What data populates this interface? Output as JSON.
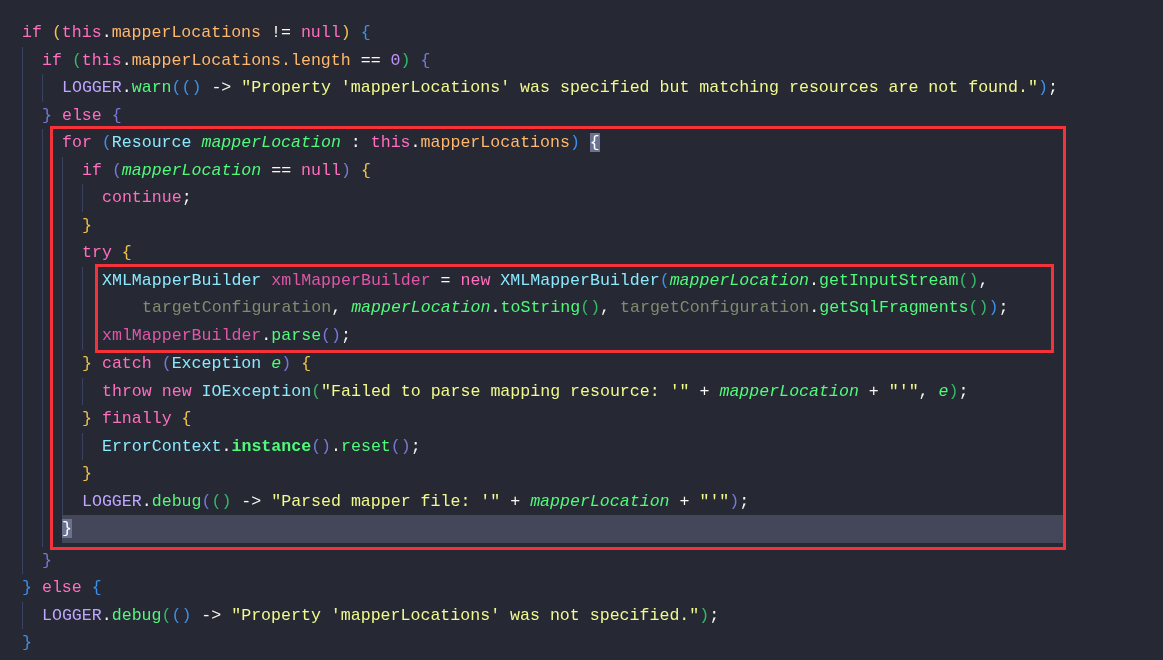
{
  "editor": {
    "lines": [
      {
        "kind": "line",
        "current": false,
        "tokens": [
          {
            "text": "if ",
            "kind": "keyword"
          },
          {
            "text": "(",
            "kind": "bracket1"
          },
          {
            "text": "this",
            "kind": "keyword"
          },
          {
            "text": ".",
            "kind": "plain"
          },
          {
            "text": "mapperLocations",
            "kind": "field"
          },
          {
            "text": " != ",
            "kind": "plain"
          },
          {
            "text": "null",
            "kind": "keyword"
          },
          {
            "text": ")",
            "kind": "bracket1"
          },
          {
            "text": " {",
            "kind": "bracket2"
          }
        ],
        "children": [
          {
            "kind": "line",
            "current": false,
            "tokens": [
              {
                "text": "if ",
                "kind": "keyword"
              },
              {
                "text": "(",
                "kind": "bracket3"
              },
              {
                "text": "this",
                "kind": "keyword"
              },
              {
                "text": ".",
                "kind": "plain"
              },
              {
                "text": "mapperLocations.length",
                "kind": "field"
              },
              {
                "text": " == ",
                "kind": "plain"
              },
              {
                "text": "0",
                "kind": "number"
              },
              {
                "text": ")",
                "kind": "bracket3"
              },
              {
                "text": " {",
                "kind": "bracket4"
              }
            ],
            "children": [
              {
                "kind": "line",
                "current": false,
                "tokens": [
                  {
                    "text": "LOGGER",
                    "kind": "constant"
                  },
                  {
                    "text": ".",
                    "kind": "plain"
                  },
                  {
                    "text": "warn",
                    "kind": "method"
                  },
                  {
                    "text": "(()",
                    "kind": "bracket2"
                  },
                  {
                    "text": " -> ",
                    "kind": "plain"
                  },
                  {
                    "text": "\"Property 'mapperLocations' was specified but matching resources are not found.\"",
                    "kind": "string"
                  },
                  {
                    "text": ")",
                    "kind": "bracket2"
                  },
                  {
                    "text": ";",
                    "kind": "plain"
                  }
                ]
              }
            ]
          },
          {
            "kind": "line",
            "current": false,
            "tokens": [
              {
                "text": "} ",
                "kind": "bracket4"
              },
              {
                "text": "else ",
                "kind": "keyword"
              },
              {
                "text": "{",
                "kind": "bracket4"
              }
            ],
            "children": [
              {
                "kind": "box",
                "children": [
                  {
                    "kind": "line",
                    "current": false,
                    "tokens": [
                      {
                        "text": "for ",
                        "kind": "keyword"
                      },
                      {
                        "text": "(",
                        "kind": "bracket2"
                      },
                      {
                        "text": "Resource ",
                        "kind": "class"
                      },
                      {
                        "text": "mapperLocation",
                        "kind": "param"
                      },
                      {
                        "text": " : ",
                        "kind": "plain"
                      },
                      {
                        "text": "this",
                        "kind": "keyword"
                      },
                      {
                        "text": ".",
                        "kind": "plain"
                      },
                      {
                        "text": "mapperLocations",
                        "kind": "field"
                      },
                      {
                        "text": ") ",
                        "kind": "bracket2"
                      },
                      {
                        "text": "{",
                        "kind": "match"
                      }
                    ],
                    "children": [
                      {
                        "kind": "line",
                        "current": false,
                        "tokens": [
                          {
                            "text": "if ",
                            "kind": "keyword"
                          },
                          {
                            "text": "(",
                            "kind": "bracket4"
                          },
                          {
                            "text": "mapperLocation",
                            "kind": "param"
                          },
                          {
                            "text": " == ",
                            "kind": "plain"
                          },
                          {
                            "text": "null",
                            "kind": "keyword"
                          },
                          {
                            "text": ")",
                            "kind": "bracket4"
                          },
                          {
                            "text": " {",
                            "kind": "bracket1"
                          }
                        ],
                        "children": [
                          {
                            "kind": "line",
                            "current": false,
                            "tokens": [
                              {
                                "text": "continue",
                                "kind": "keyword"
                              },
                              {
                                "text": ";",
                                "kind": "plain"
                              }
                            ]
                          }
                        ]
                      },
                      {
                        "kind": "line",
                        "current": false,
                        "tokens": [
                          {
                            "text": "}",
                            "kind": "bracket1"
                          }
                        ]
                      },
                      {
                        "kind": "line",
                        "current": false,
                        "tokens": [
                          {
                            "text": "try ",
                            "kind": "keyword"
                          },
                          {
                            "text": "{",
                            "kind": "bracket1"
                          }
                        ],
                        "children": [
                          {
                            "kind": "box",
                            "children": [
                              {
                                "kind": "line",
                                "current": false,
                                "tokens": [
                                  {
                                    "text": "XMLMapperBuilder ",
                                    "kind": "class"
                                  },
                                  {
                                    "text": "xmlMapperBuilder",
                                    "kind": "local"
                                  },
                                  {
                                    "text": " = ",
                                    "kind": "plain"
                                  },
                                  {
                                    "text": "new ",
                                    "kind": "keyword"
                                  },
                                  {
                                    "text": "XMLMapperBuilder",
                                    "kind": "class"
                                  },
                                  {
                                    "text": "(",
                                    "kind": "bracket2"
                                  },
                                  {
                                    "text": "mapperLocation",
                                    "kind": "param"
                                  },
                                  {
                                    "text": ".",
                                    "kind": "plain"
                                  },
                                  {
                                    "text": "getInputStream",
                                    "kind": "method"
                                  },
                                  {
                                    "text": "()",
                                    "kind": "bracket3"
                                  },
                                  {
                                    "text": ",",
                                    "kind": "plain"
                                  }
                                ]
                              },
                              {
                                "kind": "continuation",
                                "current": false,
                                "tokens": [
                                  {
                                    "text": "targetConfiguration",
                                    "kind": "muted"
                                  },
                                  {
                                    "text": ", ",
                                    "kind": "plain"
                                  },
                                  {
                                    "text": "mapperLocation",
                                    "kind": "param"
                                  },
                                  {
                                    "text": ".",
                                    "kind": "plain"
                                  },
                                  {
                                    "text": "toString",
                                    "kind": "method"
                                  },
                                  {
                                    "text": "()",
                                    "kind": "bracket3"
                                  },
                                  {
                                    "text": ", ",
                                    "kind": "plain"
                                  },
                                  {
                                    "text": "targetConfiguration",
                                    "kind": "muted"
                                  },
                                  {
                                    "text": ".",
                                    "kind": "plain"
                                  },
                                  {
                                    "text": "getSqlFragments",
                                    "kind": "method"
                                  },
                                  {
                                    "text": "()",
                                    "kind": "bracket3"
                                  },
                                  {
                                    "text": ")",
                                    "kind": "bracket2"
                                  },
                                  {
                                    "text": ";",
                                    "kind": "plain"
                                  }
                                ]
                              },
                              {
                                "kind": "line",
                                "current": false,
                                "tokens": [
                                  {
                                    "text": "xmlMapperBuilder",
                                    "kind": "local"
                                  },
                                  {
                                    "text": ".",
                                    "kind": "plain"
                                  },
                                  {
                                    "text": "parse",
                                    "kind": "method"
                                  },
                                  {
                                    "text": "()",
                                    "kind": "bracket4"
                                  },
                                  {
                                    "text": ";",
                                    "kind": "plain"
                                  }
                                ]
                              }
                            ]
                          }
                        ]
                      },
                      {
                        "kind": "line",
                        "current": false,
                        "tokens": [
                          {
                            "text": "} ",
                            "kind": "bracket1"
                          },
                          {
                            "text": "catch ",
                            "kind": "keyword"
                          },
                          {
                            "text": "(",
                            "kind": "bracket4"
                          },
                          {
                            "text": "Exception ",
                            "kind": "class"
                          },
                          {
                            "text": "e",
                            "kind": "param"
                          },
                          {
                            "text": ")",
                            "kind": "bracket4"
                          },
                          {
                            "text": " {",
                            "kind": "bracket1"
                          }
                        ],
                        "children": [
                          {
                            "kind": "line",
                            "current": false,
                            "tokens": [
                              {
                                "text": "throw new ",
                                "kind": "keyword"
                              },
                              {
                                "text": "IOException",
                                "kind": "class"
                              },
                              {
                                "text": "(",
                                "kind": "bracket3"
                              },
                              {
                                "text": "\"Failed to parse mapping resource: '\"",
                                "kind": "string"
                              },
                              {
                                "text": " + ",
                                "kind": "plain"
                              },
                              {
                                "text": "mapperLocation",
                                "kind": "param"
                              },
                              {
                                "text": " + ",
                                "kind": "plain"
                              },
                              {
                                "text": "\"'\"",
                                "kind": "string"
                              },
                              {
                                "text": ", ",
                                "kind": "plain"
                              },
                              {
                                "text": "e",
                                "kind": "param"
                              },
                              {
                                "text": ")",
                                "kind": "bracket3"
                              },
                              {
                                "text": ";",
                                "kind": "plain"
                              }
                            ]
                          }
                        ]
                      },
                      {
                        "kind": "line",
                        "current": false,
                        "tokens": [
                          {
                            "text": "} ",
                            "kind": "bracket1"
                          },
                          {
                            "text": "finally ",
                            "kind": "keyword"
                          },
                          {
                            "text": "{",
                            "kind": "bracket1"
                          }
                        ],
                        "children": [
                          {
                            "kind": "line",
                            "current": false,
                            "tokens": [
                              {
                                "text": "ErrorContext",
                                "kind": "class"
                              },
                              {
                                "text": ".",
                                "kind": "plain"
                              },
                              {
                                "text": "instance",
                                "kind": "static"
                              },
                              {
                                "text": "()",
                                "kind": "bracket4"
                              },
                              {
                                "text": ".",
                                "kind": "plain"
                              },
                              {
                                "text": "reset",
                                "kind": "method"
                              },
                              {
                                "text": "()",
                                "kind": "bracket4"
                              },
                              {
                                "text": ";",
                                "kind": "plain"
                              }
                            ]
                          }
                        ]
                      },
                      {
                        "kind": "line",
                        "current": false,
                        "tokens": [
                          {
                            "text": "}",
                            "kind": "bracket1"
                          }
                        ]
                      },
                      {
                        "kind": "line",
                        "current": false,
                        "tokens": [
                          {
                            "text": "LOGGER",
                            "kind": "constant"
                          },
                          {
                            "text": ".",
                            "kind": "plain"
                          },
                          {
                            "text": "debug",
                            "kind": "method"
                          },
                          {
                            "text": "(",
                            "kind": "bracket4"
                          },
                          {
                            "text": "()",
                            "kind": "bracket3"
                          },
                          {
                            "text": " -> ",
                            "kind": "plain"
                          },
                          {
                            "text": "\"Parsed mapper file: '\"",
                            "kind": "string"
                          },
                          {
                            "text": " + ",
                            "kind": "plain"
                          },
                          {
                            "text": "mapperLocation",
                            "kind": "param"
                          },
                          {
                            "text": " + ",
                            "kind": "plain"
                          },
                          {
                            "text": "\"'\"",
                            "kind": "string"
                          },
                          {
                            "text": ")",
                            "kind": "bracket4"
                          },
                          {
                            "text": ";",
                            "kind": "plain"
                          }
                        ]
                      }
                    ]
                  },
                  {
                    "kind": "line",
                    "current": true,
                    "tokens": [
                      {
                        "text": "}",
                        "kind": "match"
                      }
                    ]
                  }
                ]
              }
            ]
          },
          {
            "kind": "line",
            "current": false,
            "tokens": [
              {
                "text": "}",
                "kind": "bracket4"
              }
            ]
          }
        ]
      },
      {
        "kind": "line",
        "current": false,
        "tokens": [
          {
            "text": "} ",
            "kind": "bracket2"
          },
          {
            "text": "else ",
            "kind": "keyword"
          },
          {
            "text": "{",
            "kind": "bracket2"
          }
        ],
        "children": [
          {
            "kind": "line",
            "current": false,
            "tokens": [
              {
                "text": "LOGGER",
                "kind": "constant"
              },
              {
                "text": ".",
                "kind": "plain"
              },
              {
                "text": "debug",
                "kind": "method"
              },
              {
                "text": "(",
                "kind": "bracket3"
              },
              {
                "text": "()",
                "kind": "bracket2"
              },
              {
                "text": " -> ",
                "kind": "plain"
              },
              {
                "text": "\"Property 'mapperLocations' was not specified.\"",
                "kind": "string"
              },
              {
                "text": ")",
                "kind": "bracket3"
              },
              {
                "text": ";",
                "kind": "plain"
              }
            ]
          }
        ]
      },
      {
        "kind": "line",
        "current": false,
        "tokens": [
          {
            "text": "}",
            "kind": "bracket2"
          }
        ]
      }
    ]
  }
}
